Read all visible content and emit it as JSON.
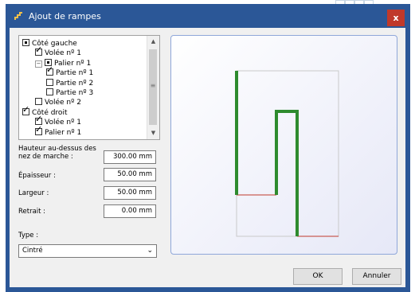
{
  "window": {
    "title": "Ajout de rampes",
    "close_label": "x"
  },
  "tree": {
    "items": [
      {
        "label": "Côté gauche",
        "state": "partial",
        "expander": "",
        "level": 0
      },
      {
        "label": "Volée nº 1",
        "state": "checked",
        "expander": "",
        "level": 1
      },
      {
        "label": "Palier nº 1",
        "state": "partial",
        "expander": "−",
        "level": 1
      },
      {
        "label": "Partie nº 1",
        "state": "checked",
        "expander": "",
        "level": 2
      },
      {
        "label": "Partie nº 2",
        "state": "unchecked",
        "expander": "",
        "level": 2
      },
      {
        "label": "Partie nº 3",
        "state": "unchecked",
        "expander": "",
        "level": 2
      },
      {
        "label": "Volée nº 2",
        "state": "unchecked",
        "expander": "",
        "level": 1
      },
      {
        "label": "Côté droit",
        "state": "checked",
        "expander": "",
        "level": 0
      },
      {
        "label": "Volée nº 1",
        "state": "checked",
        "expander": "",
        "level": 1
      },
      {
        "label": "Palier nº 1",
        "state": "checked",
        "expander": "",
        "level": 1
      }
    ]
  },
  "fields": {
    "hauteur_label": "Hauteur au-dessus des nez de marche :",
    "hauteur_value": "300.00 mm",
    "epaisseur_label": "Épaisseur :",
    "epaisseur_value": "50.00 mm",
    "largeur_label": "Largeur :",
    "largeur_value": "50.00 mm",
    "retrait_label": "Retrait :",
    "retrait_value": "0.00 mm",
    "type_label": "Type :",
    "type_value": "Cintré"
  },
  "buttons": {
    "ok": "OK",
    "cancel": "Annuler"
  },
  "colors": {
    "title_bar": "#2b5797",
    "close": "#c0392b",
    "rail": "#2e8b2e",
    "edge_red": "#c0392b"
  }
}
